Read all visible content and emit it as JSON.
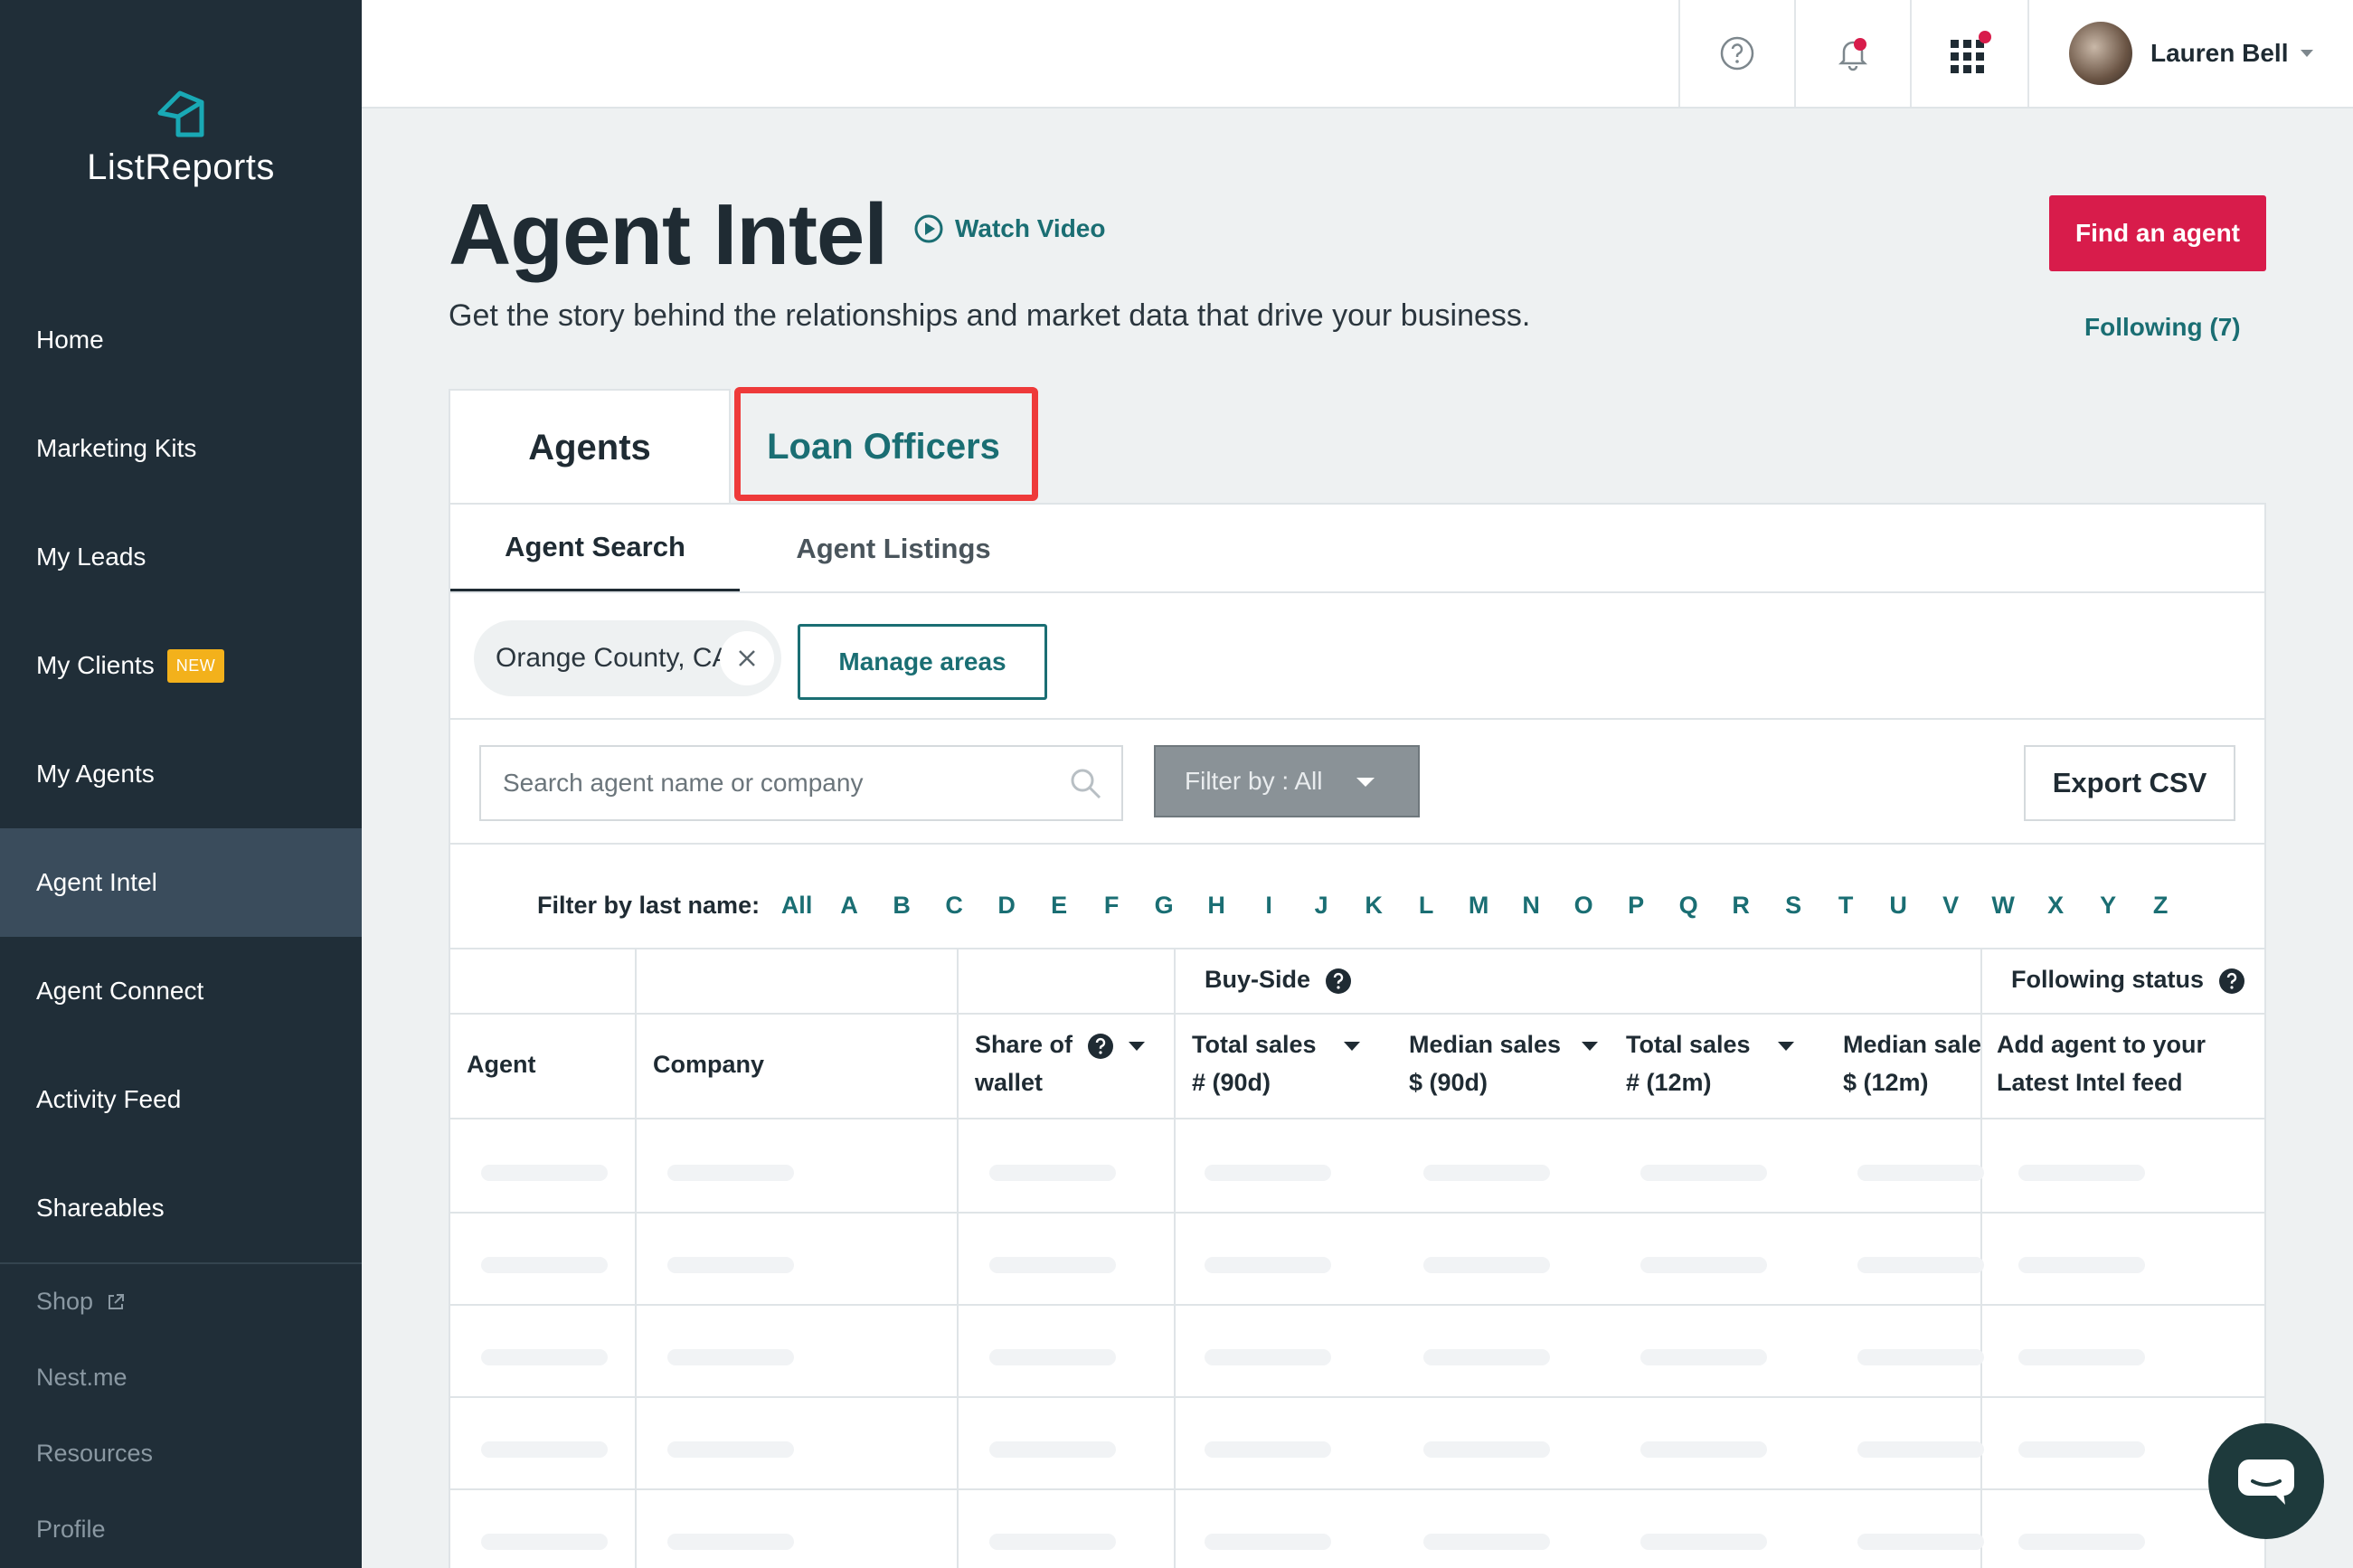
{
  "brand": {
    "name": "ListReports",
    "accent": "#1a6e73",
    "sidebar_bg": "#202e38",
    "primary_button": "#d81c4b"
  },
  "sidebar": {
    "items": [
      {
        "label": "Home"
      },
      {
        "label": "Marketing Kits"
      },
      {
        "label": "My Leads"
      },
      {
        "label": "My Clients",
        "badge": "NEW"
      },
      {
        "label": "My Agents"
      },
      {
        "label": "Agent Intel",
        "active": true
      },
      {
        "label": "Agent Connect"
      },
      {
        "label": "Activity Feed"
      },
      {
        "label": "Shareables"
      }
    ],
    "secondary": [
      {
        "label": "Shop",
        "icon": "external-link-icon"
      },
      {
        "label": "Nest.me"
      },
      {
        "label": "Resources"
      },
      {
        "label": "Profile"
      }
    ]
  },
  "topbar": {
    "icons": [
      "help-icon",
      "notification-bell-icon",
      "apps-grid-icon"
    ],
    "user_name": "Lauren Bell"
  },
  "page": {
    "title": "Agent Intel",
    "watch_video": "Watch Video",
    "subtitle": "Get the story behind the relationships and market data that drive your business.",
    "find_agent": "Find an agent",
    "following": "Following (7)"
  },
  "tabs": {
    "agents": "Agents",
    "loan_officers": "Loan Officers"
  },
  "subtabs": {
    "search": "Agent Search",
    "listings": "Agent Listings"
  },
  "area_chip": {
    "label": "Orange County, CA"
  },
  "manage_areas": "Manage areas",
  "search": {
    "placeholder": "Search agent name or company"
  },
  "filter": {
    "label": "Filter by : All"
  },
  "export_csv": "Export CSV",
  "alpha_filter": {
    "label": "Filter by last name:",
    "letters": [
      "All",
      "A",
      "B",
      "C",
      "D",
      "E",
      "F",
      "G",
      "H",
      "I",
      "J",
      "K",
      "L",
      "M",
      "N",
      "O",
      "P",
      "Q",
      "R",
      "S",
      "T",
      "U",
      "V",
      "W",
      "X",
      "Y",
      "Z"
    ]
  },
  "table": {
    "group_buy_side": "Buy-Side",
    "group_following": "Following status",
    "columns": {
      "agent": "Agent",
      "company": "Company",
      "share_l1": "Share of",
      "share_l2": "wallet",
      "ts90_l1": "Total sales",
      "ts90_l2": "# (90d)",
      "ms90_l1": "Median sales",
      "ms90_l2": "$ (90d)",
      "ts12_l1": "Total sales",
      "ts12_l2": "# (12m)",
      "ms12_l1": "Median sale",
      "ms12_l2": "$ (12m)",
      "follow_l1": "Add agent to your",
      "follow_l2": "Latest Intel feed"
    }
  }
}
